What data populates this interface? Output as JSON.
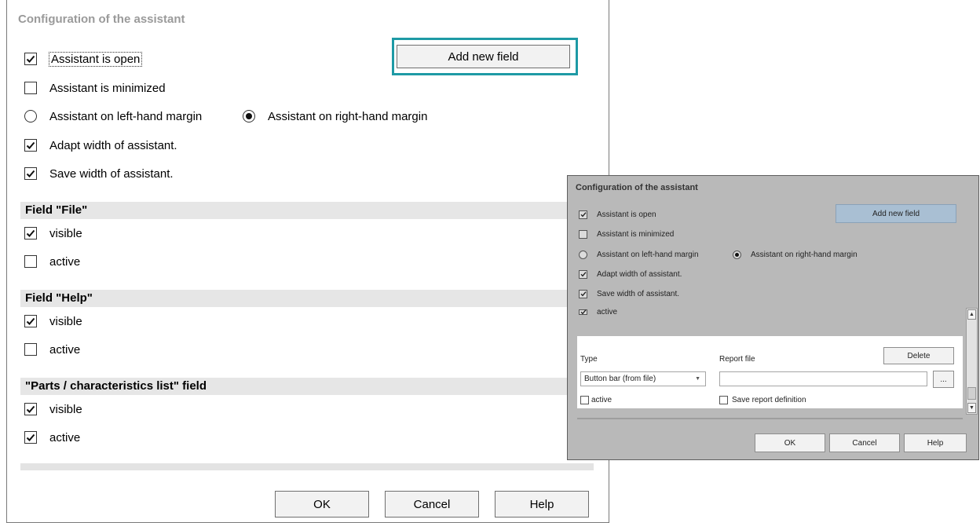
{
  "main_dialog": {
    "title": "Configuration of the assistant",
    "add_field_button": "Add new field",
    "options": {
      "assistant_open": "Assistant is open",
      "assistant_minimized": "Assistant is minimized",
      "left_margin": "Assistant on left-hand margin",
      "right_margin": "Assistant on right-hand margin",
      "adapt_width": "Adapt width of assistant.",
      "save_width": "Save width of assistant."
    },
    "sections": [
      {
        "title": "Field \"File\"",
        "visible": "visible",
        "active": "active"
      },
      {
        "title": "Field \"Help\"",
        "visible": "visible",
        "active": "active"
      },
      {
        "title": "\"Parts / characteristics list\" field",
        "visible": "visible",
        "active": "active"
      }
    ],
    "buttons": {
      "ok": "OK",
      "cancel": "Cancel",
      "help": "Help"
    }
  },
  "inset": {
    "title": "Configuration of the assistant",
    "add_field_button": "Add new field",
    "options": {
      "assistant_open": "Assistant is open",
      "assistant_minimized": "Assistant is minimized",
      "left_margin": "Assistant on left-hand margin",
      "right_margin": "Assistant on right-hand margin",
      "adapt_width": "Adapt width of assistant.",
      "save_width": "Save width of assistant.",
      "active": "active"
    },
    "panel": {
      "type_label": "Type",
      "report_file_label": "Report file",
      "delete_button": "Delete",
      "type_value": "Button bar (from file)",
      "browse_button": "...",
      "active": "active",
      "save_report": "Save report definition"
    },
    "buttons": {
      "ok": "OK",
      "cancel": "Cancel",
      "help": "Help"
    }
  },
  "colors": {
    "highlight": "#1e9aa5",
    "inset_bg": "#b9b9b9",
    "inset_button": "#a9bfd3"
  },
  "icons": {
    "check": "checkmark-icon",
    "radio": "radio-dot-icon",
    "caret": "caret-down-icon"
  }
}
